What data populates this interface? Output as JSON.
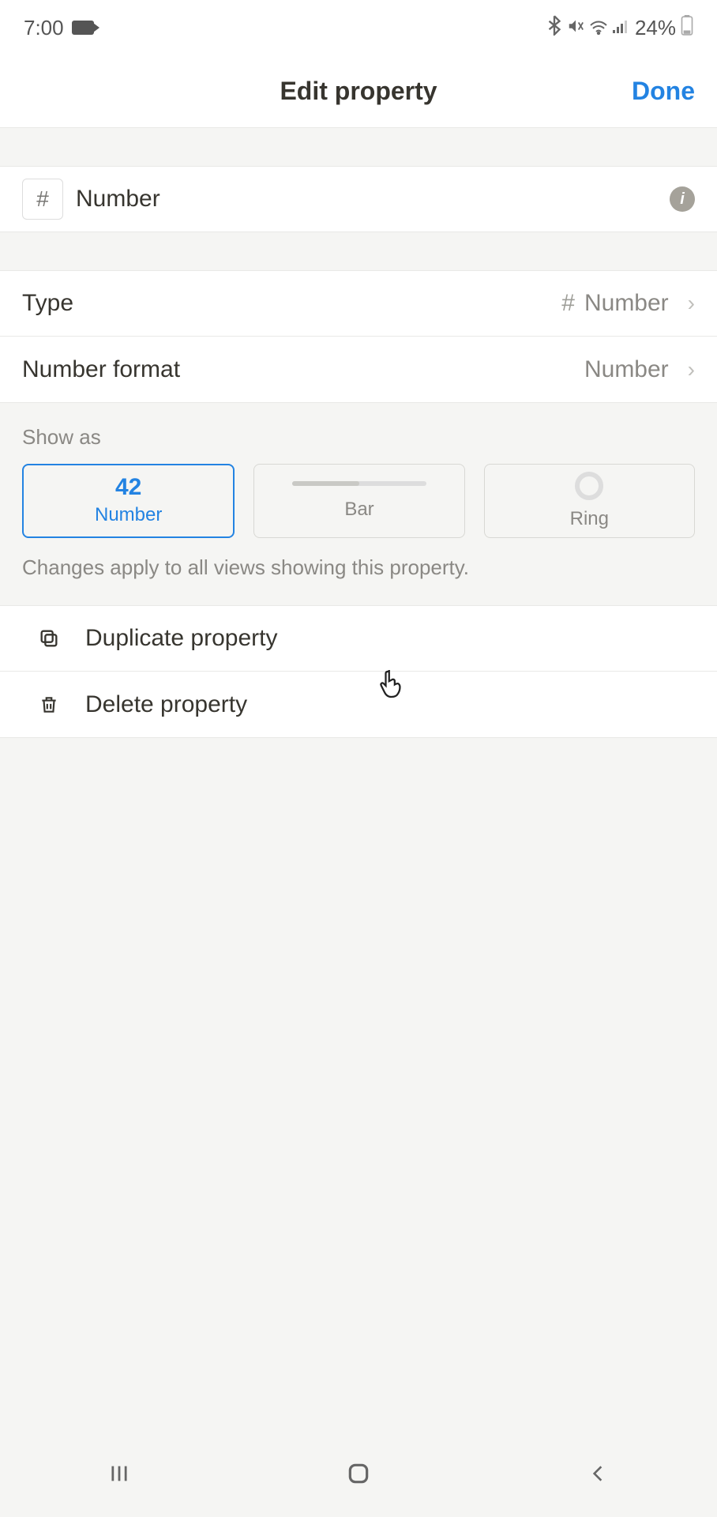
{
  "status": {
    "time": "7:00",
    "battery": "24%"
  },
  "header": {
    "title": "Edit property",
    "done": "Done"
  },
  "property": {
    "icon": "#",
    "name": "Number"
  },
  "rows": {
    "type_label": "Type",
    "type_value": "Number",
    "format_label": "Number format",
    "format_value": "Number"
  },
  "show_as": {
    "label": "Show as",
    "number_value": "42",
    "number_label": "Number",
    "bar_label": "Bar",
    "ring_label": "Ring",
    "helper": "Changes apply to all views showing this property."
  },
  "actions": {
    "duplicate": "Duplicate property",
    "delete": "Delete property"
  }
}
